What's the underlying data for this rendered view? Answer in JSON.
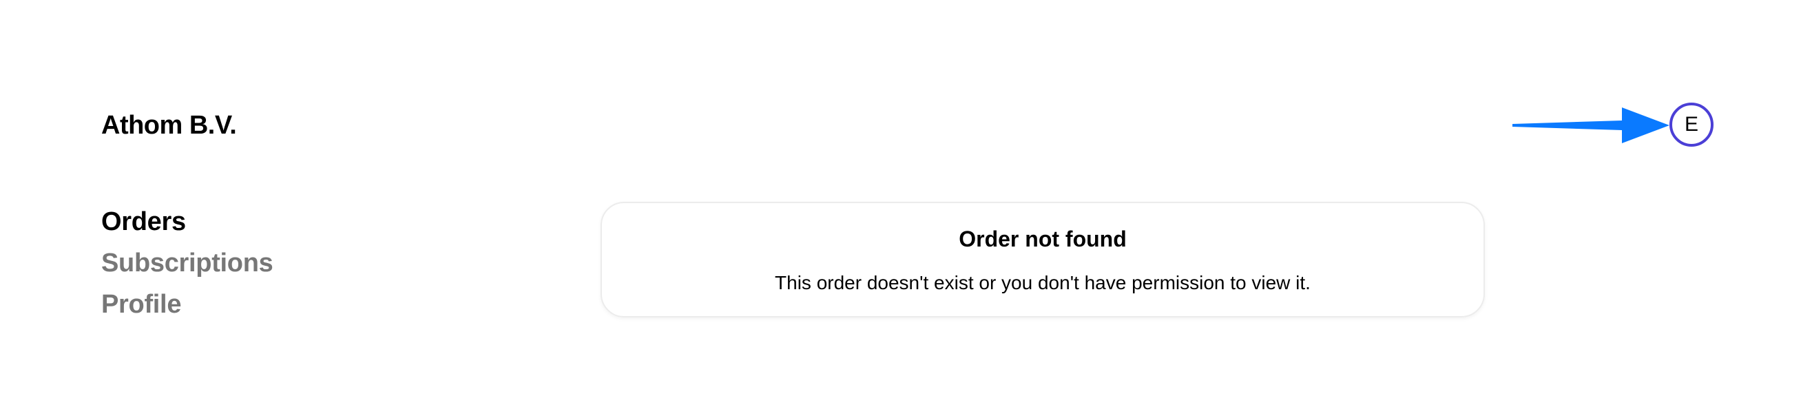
{
  "header": {
    "brand": "Athom B.V.",
    "avatar_initial": "E"
  },
  "colors": {
    "avatar_border": "#4b3fd6",
    "arrow": "#0a7aff",
    "nav_inactive": "#777777",
    "nav_active": "#000000"
  },
  "sidebar": {
    "items": [
      {
        "label": "Orders",
        "active": true
      },
      {
        "label": "Subscriptions",
        "active": false
      },
      {
        "label": "Profile",
        "active": false
      }
    ]
  },
  "main": {
    "error_card": {
      "title": "Order not found",
      "message": "This order doesn't exist or you don't have permission to view it."
    }
  },
  "icons": {
    "annotation_arrow": "arrow-right-icon"
  }
}
